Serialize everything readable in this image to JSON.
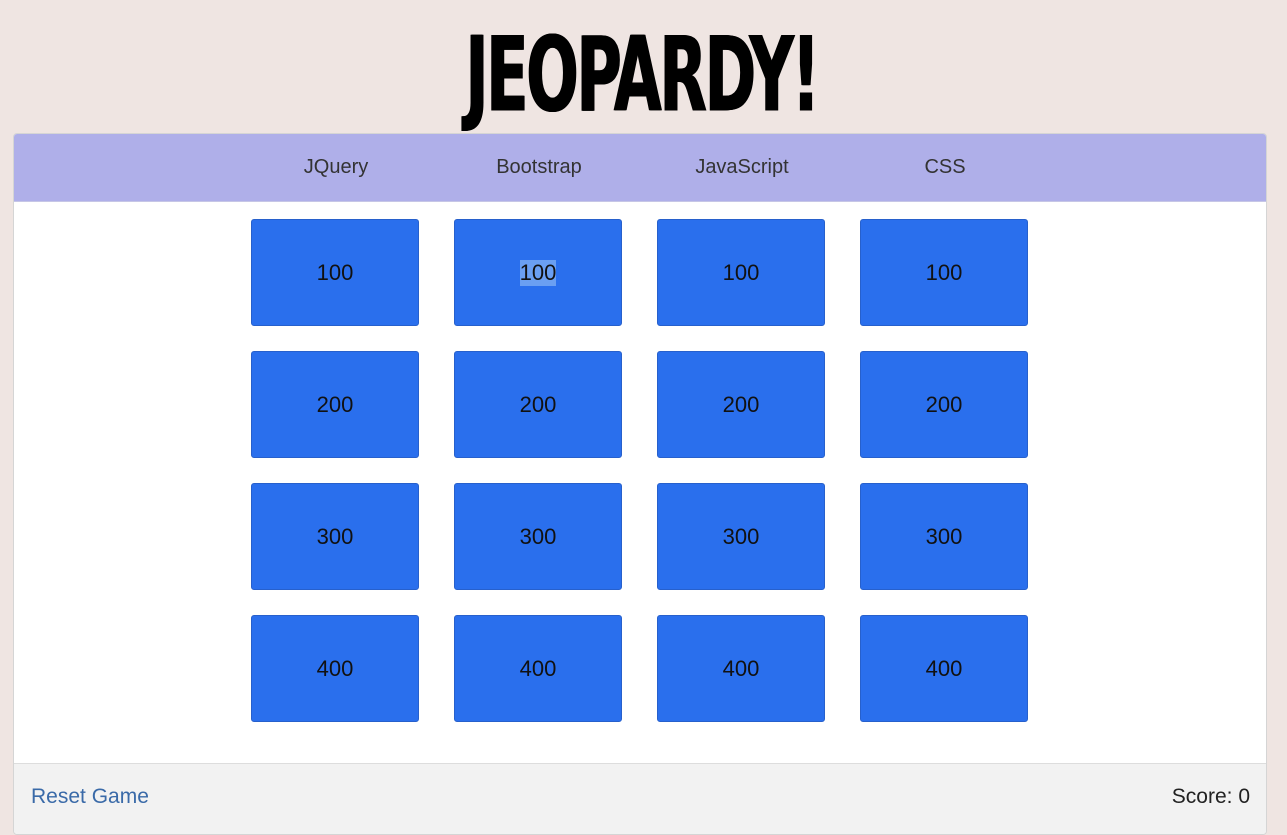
{
  "logo": {
    "text": "JEOPARDY!"
  },
  "categories": [
    {
      "label": "JQuery"
    },
    {
      "label": "Bootstrap"
    },
    {
      "label": "JavaScript"
    },
    {
      "label": "CSS"
    }
  ],
  "tiles": [
    [
      "100",
      "100",
      "100",
      "100"
    ],
    [
      "200",
      "200",
      "200",
      "200"
    ],
    [
      "300",
      "300",
      "300",
      "300"
    ],
    [
      "400",
      "400",
      "400",
      "400"
    ]
  ],
  "selected_tile": {
    "row": 0,
    "col": 1
  },
  "footer": {
    "reset_label": "Reset Game",
    "score_label": "Score:",
    "score_value": "0"
  },
  "colors": {
    "background": "#efe5e2",
    "header": "#afafe9",
    "tile": "#2a6fed",
    "link": "#3a6aa8"
  }
}
